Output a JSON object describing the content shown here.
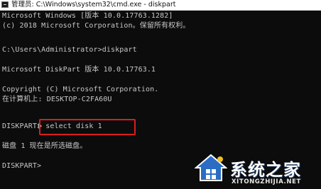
{
  "window": {
    "title": "管理员: C:\\Windows\\system32\\cmd.exe - diskpart"
  },
  "console": {
    "lines": [
      "Microsoft Windows [版本 10.0.17763.1282]",
      "(c) 2018 Microsoft Corporation。保留所有权利。",
      "",
      "C:\\Users\\Administrator>diskpart",
      "",
      "Microsoft DiskPart 版本 10.0.17763.1",
      "",
      "Copyright (C) Microsoft Corporation.",
      "在计算机上: DESKTOP-C2FA60U",
      "",
      "DISKPART> select disk 1",
      "",
      "磁盘 1 现在是所选磁盘。",
      "",
      "DISKPART>"
    ]
  },
  "highlight": {
    "color": "#d81e1e",
    "target": "select disk 1"
  },
  "watermark": {
    "brand": "系统之家",
    "url": "XITONGZHIJIA.NET",
    "logo_icon": "house-logo-icon"
  },
  "colors": {
    "console_bg": "#0c0c0c",
    "console_fg": "#c8c8c8",
    "titlebar_bg": "#ffffff"
  }
}
